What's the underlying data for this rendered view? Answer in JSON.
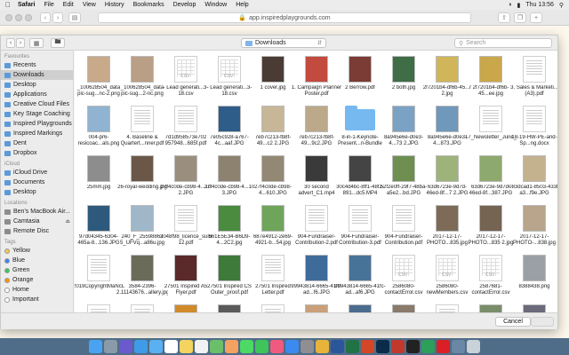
{
  "menubar": {
    "apple": "",
    "items": [
      "Safari",
      "File",
      "Edit",
      "View",
      "History",
      "Bookmarks",
      "Develop",
      "Window",
      "Help"
    ],
    "clock": "Thu 13:56"
  },
  "browser": {
    "url": "app.inspiredplaygrounds.com"
  },
  "dialog": {
    "location": "Downloads",
    "search_placeholder": "Search",
    "cancel_label": "Cancel",
    "choose_label": "Choose"
  },
  "sidebar": {
    "sections": [
      {
        "title": "Favourites",
        "items": [
          {
            "label": "Recents",
            "icon": "clock-icon",
            "color": "#5c9ad9"
          },
          {
            "label": "Downloads",
            "icon": "downloads-icon",
            "color": "#5c9ad9",
            "selected": true
          },
          {
            "label": "Desktop",
            "icon": "desktop-icon",
            "color": "#5c9ad9"
          },
          {
            "label": "Applications",
            "icon": "applications-icon",
            "color": "#5c9ad9"
          },
          {
            "label": "Creative Cloud Files",
            "icon": "folder-icon",
            "color": "#5c9ad9"
          },
          {
            "label": "Key Stage Coaching",
            "icon": "folder-icon",
            "color": "#5c9ad9"
          },
          {
            "label": "Inspired Playgrounds",
            "icon": "folder-icon",
            "color": "#5c9ad9"
          },
          {
            "label": "Inspired Markings",
            "icon": "folder-icon",
            "color": "#5c9ad9"
          },
          {
            "label": "Dent",
            "icon": "folder-icon",
            "color": "#5c9ad9"
          },
          {
            "label": "Dropbox",
            "icon": "dropbox-icon",
            "color": "#5c9ad9"
          }
        ]
      },
      {
        "title": "iCloud",
        "items": [
          {
            "label": "iCloud Drive",
            "icon": "cloud-icon",
            "color": "#5c9ad9"
          },
          {
            "label": "Documents",
            "icon": "document-icon",
            "color": "#5c9ad9"
          },
          {
            "label": "Desktop",
            "icon": "desktop-icon",
            "color": "#5c9ad9"
          }
        ]
      },
      {
        "title": "Locations",
        "items": [
          {
            "label": "Ben's MacBook Air...",
            "icon": "laptop-icon",
            "color": "#8d8d8d"
          },
          {
            "label": "Camtasia",
            "icon": "disk-icon",
            "color": "#8d8d8d",
            "eject": true
          },
          {
            "label": "Remote Disc",
            "icon": "disc-icon",
            "color": "#8d8d8d"
          }
        ]
      },
      {
        "title": "Tags",
        "items": [
          {
            "label": "Yellow",
            "icon": "tag-dot-icon",
            "color": "#f2c94c",
            "dot": true
          },
          {
            "label": "Blue",
            "icon": "tag-dot-icon",
            "color": "#3b82f6",
            "dot": true
          },
          {
            "label": "Green",
            "icon": "tag-dot-icon",
            "color": "#34c759",
            "dot": true
          },
          {
            "label": "Orange",
            "icon": "tag-dot-icon",
            "color": "#ff9500",
            "dot": true
          },
          {
            "label": "Home",
            "icon": "tag-dot-icon",
            "color": "#ffffff",
            "dot": true
          },
          {
            "label": "Important",
            "icon": "tag-dot-icon",
            "color": "#ffffff",
            "dot": true
          }
        ]
      }
    ]
  },
  "files": [
    {
      "name": "_100628504_data pic-sug...nc-2.png",
      "kind": "photo",
      "color": "#c8a98a"
    },
    {
      "name": "_100628504_data pic-sug...2-nc.png",
      "kind": "photo",
      "color": "#b99f86"
    },
    {
      "name": "- Lead generati...3-18.csv",
      "kind": "sheet",
      "tag": "CSV"
    },
    {
      "name": "- Lead generati...3-18.csv",
      "kind": "sheet",
      "tag": "CSV"
    },
    {
      "name": "1 cover.jpg",
      "kind": "photo",
      "color": "#4a3c34"
    },
    {
      "name": "1. Campaign Planner Poster.pdf",
      "kind": "photo",
      "color": "#c24a3e"
    },
    {
      "name": "2 Berrow.pdf",
      "kind": "photo",
      "color": "#7a3c34"
    },
    {
      "name": "2 both.jpg",
      "kind": "photo",
      "color": "#3e6d46"
    },
    {
      "name": "2f7201b4-df6b-45...r 2.jpg",
      "kind": "photo",
      "color": "#d0b55a"
    },
    {
      "name": "2f7201b4-df6b-45...ee.jpg",
      "kind": "photo",
      "color": "#c9a74a"
    },
    {
      "name": "3. Sales & Marketi...(A3).pdf",
      "kind": "doc"
    },
    {
      "name": "004-pr6-resicoac...als.png",
      "kind": "photo",
      "color": "#8fb3d0"
    },
    {
      "name": "4. Baseline & Quartert...nner.pdf",
      "kind": "doc"
    },
    {
      "name": "7d1d958573e702 957948...685f.pdf",
      "kind": "doc"
    },
    {
      "name": "7e05c928-a767-4c...aaf.JPG",
      "kind": "photo",
      "color": "#2f5d8a"
    },
    {
      "name": "7eb7c213-fb8f-49...c2 2.JPG",
      "kind": "photo",
      "color": "#c7b697"
    },
    {
      "name": "7eb7c213-fb8f-49...9c2.JPG",
      "kind": "photo",
      "color": "#bba98a"
    },
    {
      "name": "8-in-1-Keynote-Present...n-Bundle",
      "kind": "folder"
    },
    {
      "name": "8a945e6e-d0e3-4...73 2.JPG",
      "kind": "photo",
      "color": "#7aa2c5"
    },
    {
      "name": "8a945e6e-d0e3-4...873.JPG",
      "kind": "photo",
      "color": "#6f98bb"
    },
    {
      "name": "17_Newsletter_June_18.pdf",
      "kind": "doc"
    },
    {
      "name": "18-19-HW-PE-and-Sp...ng.docx",
      "kind": "doc"
    },
    {
      "name": "25mm.jpg",
      "kind": "photo",
      "color": "#8d8d8d"
    },
    {
      "name": "26-royal-wedding.jpg",
      "kind": "photo",
      "color": "#6b5748"
    },
    {
      "name": "27f4c0de-cb98-4...10 2.JPG",
      "kind": "photo",
      "color": "#9a8f7e"
    },
    {
      "name": "27f4c0de-cb98-4...10 3.JPG",
      "kind": "photo",
      "color": "#8c826f"
    },
    {
      "name": "27f4c0de-cb98-4...610.JPG",
      "kind": "photo",
      "color": "#938873"
    },
    {
      "name": "30 second advert_C1.mp4",
      "kind": "photo",
      "color": "#3a3a3a"
    },
    {
      "name": "30c4d4bc-8ff1-48f2-891...dc5.MP4",
      "kind": "photo",
      "color": "#444"
    },
    {
      "name": "52f2e0ff-29f7-48ba-a5e2...bd.JPG",
      "kind": "photo",
      "color": "#6e8f4f"
    },
    {
      "name": "63d6723e-9d7d-46ed-8f...7 2.JPG",
      "kind": "photo",
      "color": "#9db37a"
    },
    {
      "name": "63d6723e-9d7d-46ed-8f...387.JPG",
      "kind": "photo",
      "color": "#8ea96e"
    },
    {
      "name": "083dcad1-8503-433f-a3...f9e.JPG",
      "kind": "photo",
      "color": "#c4b28f"
    },
    {
      "name": "97d04345-6304-465a-8...136.JPG",
      "kind": "photo",
      "color": "#2d5a7c"
    },
    {
      "name": "240_F_25598862 5_UFVq...a86u.jpg",
      "kind": "photo",
      "color": "#9fb7c9"
    },
    {
      "name": "3048f98_licence_summ...3-12.pdf",
      "kind": "doc"
    },
    {
      "name": "561E5E34-B6D9-4...2C2.jpg",
      "kind": "photo",
      "color": "#4b8b3f"
    },
    {
      "name": "687e4912-2e69-4921-b...54.jpg",
      "kind": "photo",
      "color": "#6ea55a"
    },
    {
      "name": "904-Fundraiser-Contribution-2.pdf",
      "kind": "doc"
    },
    {
      "name": "904-Fundraiser-Contribution-3.pdf",
      "kind": "doc"
    },
    {
      "name": "904-Fundraiser-Contribution.pdf",
      "kind": "doc"
    },
    {
      "name": "2017-12-17-PHOTO...835.jpg",
      "kind": "photo",
      "color": "#7d6b58"
    },
    {
      "name": "2017-12-17-PHOTO...835 2.jpg",
      "kind": "photo",
      "color": "#756452"
    },
    {
      "name": "2017-12-17-PHOTO-...838.jpg",
      "kind": "photo",
      "color": "#b8a58c"
    },
    {
      "name": "2019CopyrightMaNcLerust...ECK.pdf",
      "kind": "doc"
    },
    {
      "name": "3584-2396-2.11143676...allery.jpg",
      "kind": "photo",
      "color": "#6b6b5a"
    },
    {
      "name": "27501 Inspired A5 Flyer.pdf",
      "kind": "photo",
      "color": "#5a2a2a"
    },
    {
      "name": "27501 Inspired CS Outer_proof.pdf",
      "kind": "photo",
      "color": "#3e7a3a"
    },
    {
      "name": "27501 Inspired Letter.pdf",
      "kind": "doc"
    },
    {
      "name": "99943814-6665-41fc-ad...f6.JPG",
      "kind": "photo",
      "color": "#3f6b9a"
    },
    {
      "name": "99943814-6665-41fc-ad...af6.JPG",
      "kind": "photo",
      "color": "#477398"
    },
    {
      "name": "2586080-contactError.csv",
      "kind": "sheet",
      "tag": "CSV"
    },
    {
      "name": "2586080-newMembers.csv",
      "kind": "sheet",
      "tag": "CSV"
    },
    {
      "name": "2587681-contactError.csv",
      "kind": "sheet",
      "tag": "CSV"
    },
    {
      "name": "8388438.png",
      "kind": "photo",
      "color": "#9aa0a6"
    },
    {
      "name": "",
      "kind": "doc"
    },
    {
      "name": "",
      "kind": "doc"
    },
    {
      "name": "",
      "kind": "photo",
      "color": "#d08a2a"
    },
    {
      "name": "",
      "kind": "photo",
      "color": "#5a5a5a"
    },
    {
      "name": "",
      "kind": "doc"
    },
    {
      "name": "",
      "kind": "photo",
      "color": "#c9a07a"
    },
    {
      "name": "",
      "kind": "photo",
      "color": "#4b6c8f"
    },
    {
      "name": "",
      "kind": "photo",
      "color": "#8a7a6a"
    },
    {
      "name": "",
      "kind": "doc"
    },
    {
      "name": "",
      "kind": "photo",
      "color": "#7a8d6a"
    },
    {
      "name": "",
      "kind": "photo",
      "color": "#6a6a7a"
    }
  ],
  "dock": [
    {
      "name": "finder-icon",
      "color": "#4aa3f0"
    },
    {
      "name": "launchpad-icon",
      "color": "#8a9aa8"
    },
    {
      "name": "siri-icon",
      "color": "#6a5acd"
    },
    {
      "name": "safari-icon",
      "color": "#3e9be8"
    },
    {
      "name": "mail-icon",
      "color": "#5ab0f0"
    },
    {
      "name": "calendar-icon",
      "color": "#ffffff"
    },
    {
      "name": "notes-icon",
      "color": "#f4d35e"
    },
    {
      "name": "reminders-icon",
      "color": "#f2f2f2"
    },
    {
      "name": "maps-icon",
      "color": "#6cbf6a"
    },
    {
      "name": "photos-icon",
      "color": "#f4a261"
    },
    {
      "name": "messages-icon",
      "color": "#4cd964"
    },
    {
      "name": "facetime-icon",
      "color": "#3ec45a"
    },
    {
      "name": "music-icon",
      "color": "#f05a7e"
    },
    {
      "name": "appstore-icon",
      "color": "#3b8af0"
    },
    {
      "name": "settings-icon",
      "color": "#8e8e93"
    },
    {
      "name": "chrome-icon",
      "color": "#e8b33a"
    },
    {
      "name": "word-icon",
      "color": "#2b579a"
    },
    {
      "name": "excel-icon",
      "color": "#217346"
    },
    {
      "name": "powerpoint-icon",
      "color": "#d24726"
    },
    {
      "name": "photoshop-icon",
      "color": "#0b2b4a"
    },
    {
      "name": "acrobat-icon",
      "color": "#c0392b"
    },
    {
      "name": "terminal-icon",
      "color": "#222222"
    },
    {
      "name": "camtasia-icon",
      "color": "#2e9e5b"
    },
    {
      "name": "creative-cloud-icon",
      "color": "#da1f26"
    },
    {
      "name": "preview-icon",
      "color": "#6a88a5"
    },
    {
      "name": "trash-icon",
      "color": "#c9d1d9"
    }
  ]
}
